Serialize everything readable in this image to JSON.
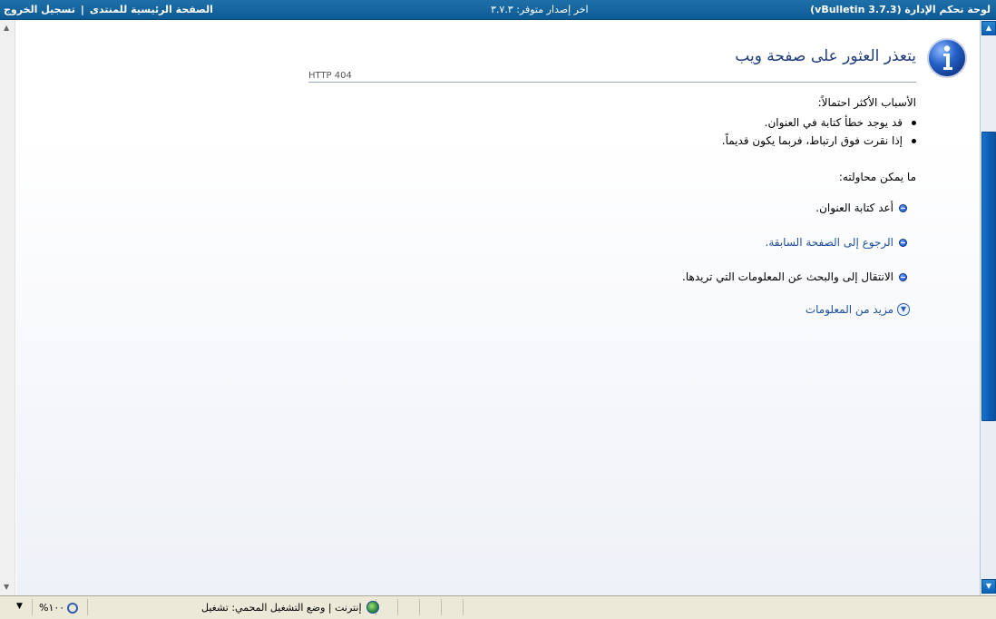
{
  "topbar": {
    "title": "لوحة تحكم الإدارة (vBulletin 3.7.3)",
    "version_notice": "اخر إصدار متوفر: ٣.٧.٣",
    "forum_home_link": "الصفحة الرئيسية للمنتدى",
    "separator": "|",
    "logout_link": "تسجيل الخروج"
  },
  "error_page": {
    "title": "يتعذر العثور على صفحة ويب",
    "http_code": "HTTP 404",
    "causes_heading": "الأسباب الأكثر احتمالاً:",
    "causes": [
      "قد يوجد خطأ كتابة في العنوان.",
      "إذا نقرت فوق ارتباط، فربما يكون قديماً."
    ],
    "try_heading": "ما يمكن محاولته:",
    "actions": [
      "أعد كتابة العنوان.",
      "الرجوع إلى الصفحة السابقة.",
      "الانتقال إلى  والبحث عن المعلومات التي تريدها."
    ],
    "more_info": "مزيد من المعلومات"
  },
  "statusbar": {
    "zone": "إنترنت | وضع التشغيل المحمي: تشغيل",
    "zoom": "١٠٠%"
  },
  "colors": {
    "topbar": "#0d5b94",
    "title": "#1f3d7a",
    "link": "#1f4f9b",
    "scrollbar": "#0c5bb0"
  }
}
